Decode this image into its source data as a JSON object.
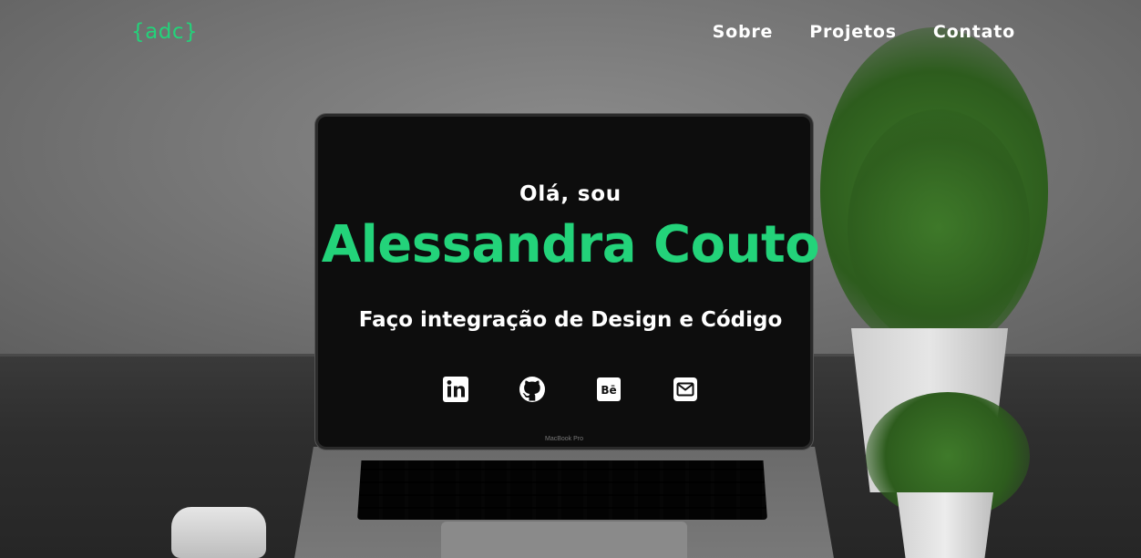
{
  "header": {
    "logo": "{adc}",
    "nav": [
      {
        "label": "Sobre"
      },
      {
        "label": "Projetos"
      },
      {
        "label": "Contato"
      }
    ]
  },
  "hero": {
    "greeting": "Olá, sou",
    "name": "Alessandra Couto",
    "subtitle": "Faço integração de Design e Código",
    "socials": [
      {
        "icon": "linkedin-icon"
      },
      {
        "icon": "github-icon"
      },
      {
        "icon": "behance-icon"
      },
      {
        "icon": "email-icon"
      }
    ]
  },
  "laptop_label": "MacBook Pro",
  "colors": {
    "accent": "#23d37a",
    "text": "#ffffff"
  }
}
